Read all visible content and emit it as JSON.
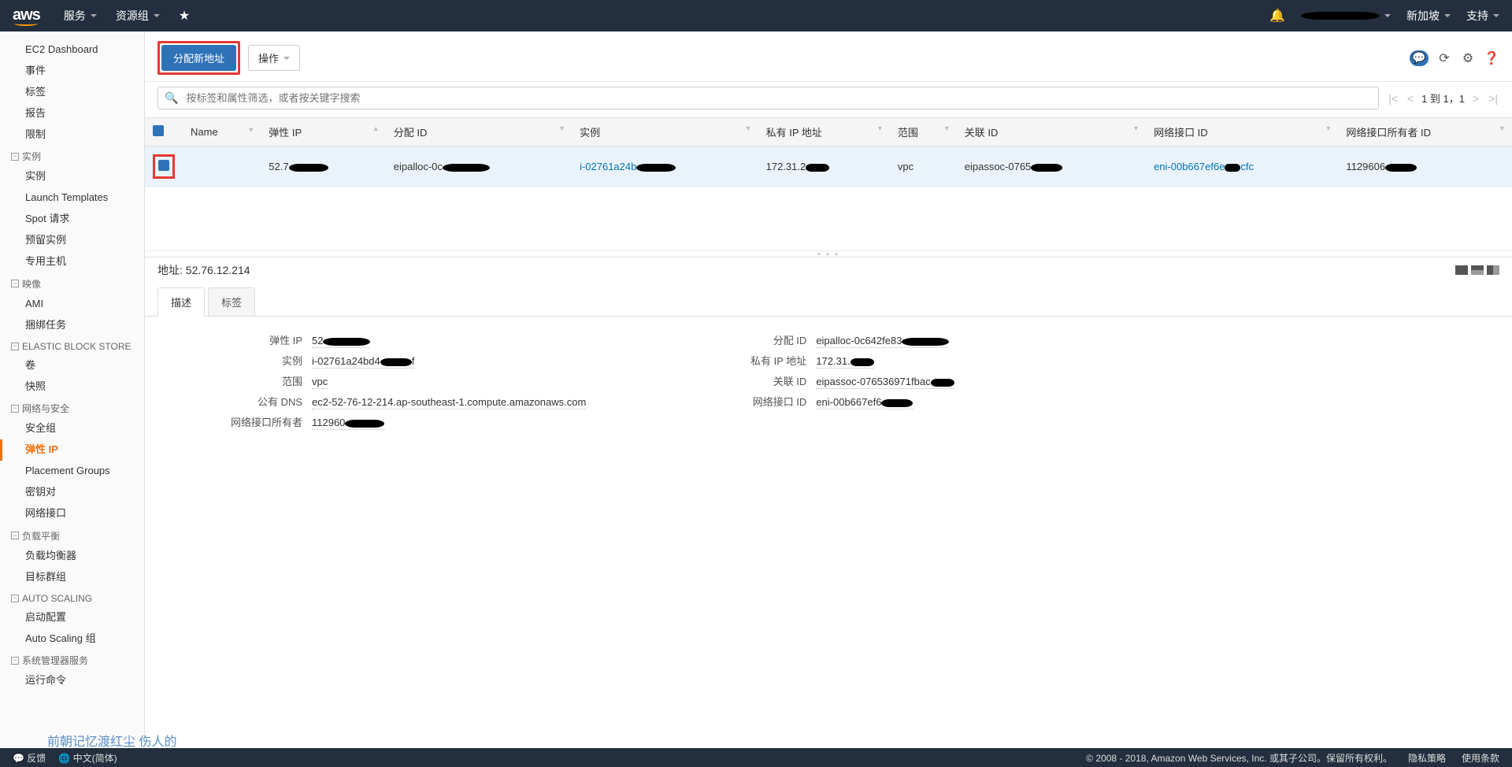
{
  "topbar": {
    "logo": "aws",
    "menu_services": "服务",
    "menu_resource_groups": "资源组",
    "region": "新加坡",
    "support": "支持"
  },
  "sidebar": {
    "items": [
      {
        "label": "EC2 Dashboard",
        "type": "item"
      },
      {
        "label": "事件",
        "type": "item"
      },
      {
        "label": "标签",
        "type": "item"
      },
      {
        "label": "报告",
        "type": "item"
      },
      {
        "label": "限制",
        "type": "item"
      },
      {
        "label": "实例",
        "type": "group"
      },
      {
        "label": "实例",
        "type": "item"
      },
      {
        "label": "Launch Templates",
        "type": "item"
      },
      {
        "label": "Spot 请求",
        "type": "item"
      },
      {
        "label": "预留实例",
        "type": "item"
      },
      {
        "label": "专用主机",
        "type": "item"
      },
      {
        "label": "映像",
        "type": "group"
      },
      {
        "label": "AMI",
        "type": "item"
      },
      {
        "label": "捆绑任务",
        "type": "item"
      },
      {
        "label": "ELASTIC BLOCK STORE",
        "type": "group"
      },
      {
        "label": "卷",
        "type": "item"
      },
      {
        "label": "快照",
        "type": "item"
      },
      {
        "label": "网络与安全",
        "type": "group"
      },
      {
        "label": "安全组",
        "type": "item"
      },
      {
        "label": "弹性 IP",
        "type": "item",
        "active": true
      },
      {
        "label": "Placement Groups",
        "type": "item"
      },
      {
        "label": "密钥对",
        "type": "item"
      },
      {
        "label": "网络接口",
        "type": "item"
      },
      {
        "label": "负载平衡",
        "type": "group"
      },
      {
        "label": "负载均衡器",
        "type": "item"
      },
      {
        "label": "目标群组",
        "type": "item"
      },
      {
        "label": "AUTO SCALING",
        "type": "group"
      },
      {
        "label": "启动配置",
        "type": "item"
      },
      {
        "label": "Auto Scaling 组",
        "type": "item"
      },
      {
        "label": "系统管理器服务",
        "type": "group"
      },
      {
        "label": "运行命令",
        "type": "item"
      }
    ]
  },
  "toolbar": {
    "allocate_btn": "分配新地址",
    "actions_btn": "操作"
  },
  "search": {
    "placeholder": "按标签和属性筛选，或者按关键字搜索"
  },
  "pager": {
    "text": "1 到 1，1"
  },
  "table": {
    "headers": [
      "Name",
      "弹性 IP",
      "分配 ID",
      "实例",
      "私有 IP 地址",
      "范围",
      "关联 ID",
      "网络接口 ID",
      "网络接口所有者 ID"
    ],
    "row": {
      "name": "",
      "eip_prefix": "52.7",
      "alloc_id_prefix": "eipalloc-0c",
      "instance_prefix": "i-02761a24b",
      "private_ip_prefix": "172.31.2",
      "scope": "vpc",
      "assoc_id_prefix": "eipassoc-0765",
      "eni_prefix": "eni-00b667ef6e",
      "eni_suffix": "cfc",
      "owner_prefix": "1129606"
    }
  },
  "detail": {
    "title_label": "地址:",
    "title_value": "52.76.12.214",
    "tabs": {
      "desc": "描述",
      "tags": "标签"
    },
    "left": {
      "eip_label": "弹性 IP",
      "eip_prefix": "52",
      "instance_label": "实例",
      "instance_prefix": "i-02761a24bd4",
      "instance_suffix": "f",
      "scope_label": "范围",
      "scope_value": "vpc",
      "dns_label": "公有 DNS",
      "dns_value": "ec2-52-76-12-214.ap-southeast-1.compute.amazonaws.com",
      "owner_label": "网络接口所有者",
      "owner_prefix": "112960"
    },
    "right": {
      "alloc_label": "分配 ID",
      "alloc_prefix": "eipalloc-0c642fe83",
      "pip_label": "私有 IP 地址",
      "pip_prefix": "172.31.",
      "assoc_label": "关联 ID",
      "assoc_prefix": "eipassoc-076536971fbac",
      "eni_label": "网络接口 ID",
      "eni_prefix": "eni-00b667ef6"
    }
  },
  "footer": {
    "feedback": "反馈",
    "lang": "中文(简体)",
    "copyright": "© 2008 - 2018, Amazon Web Services, Inc. 或其子公司。保留所有权利。",
    "privacy": "隐私策略",
    "terms": "使用条款"
  },
  "watermark": "前朝记忆渡红尘 伤人的"
}
